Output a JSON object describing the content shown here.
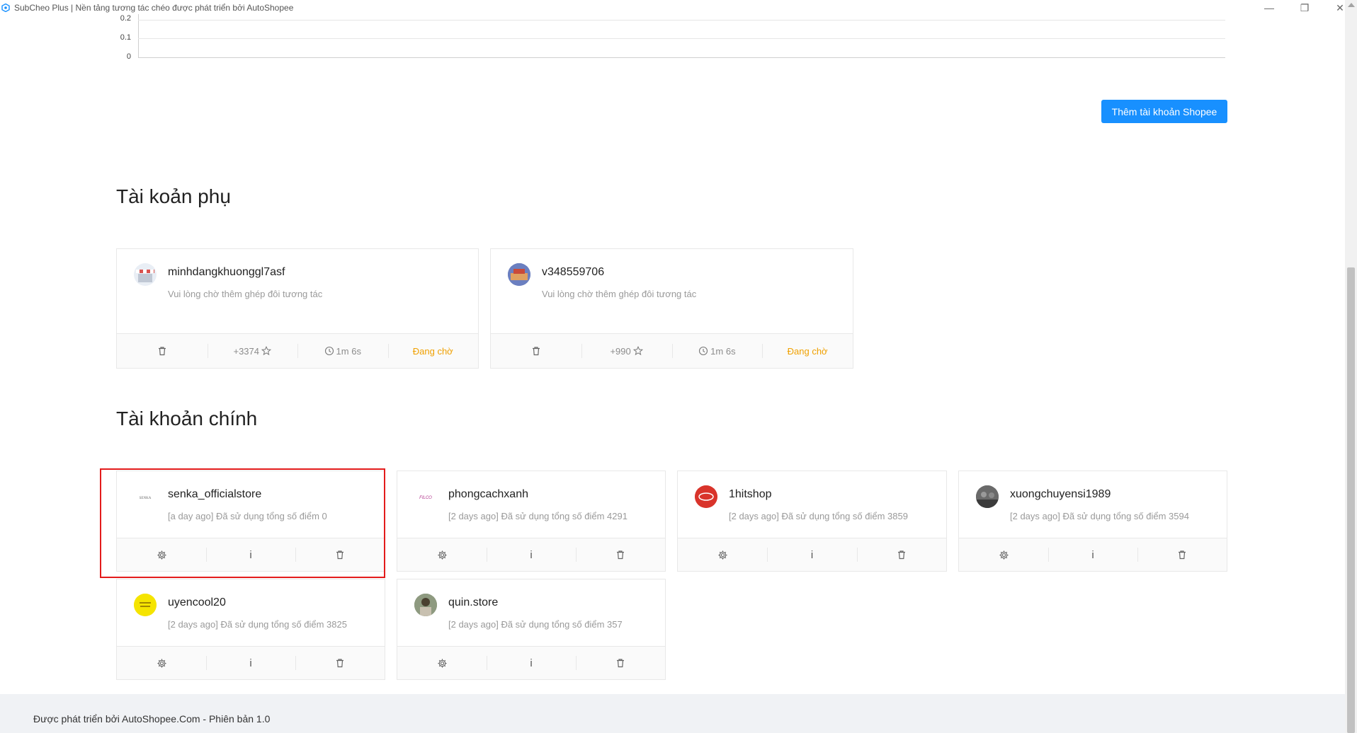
{
  "window": {
    "title": "SubCheo Plus | Nền tảng tương tác chéo được phát triển bởi AutoShopee",
    "minimize_glyph": "—",
    "restore_glyph": "❐",
    "close_glyph": "✕"
  },
  "chart": {
    "y_ticks": [
      "0.2",
      "0.1",
      "0"
    ]
  },
  "add_account_button": "Thêm tài khoản Shopee",
  "sub_section": {
    "title": "Tài koản phụ",
    "accounts": [
      {
        "name": "minhdangkhuonggl7asf",
        "desc": "Vui lòng chờ thêm ghép đôi tương tác",
        "points": "+3374",
        "time": "1m 6s",
        "status": "Đang chờ"
      },
      {
        "name": "v348559706",
        "desc": "Vui lòng chờ thêm ghép đôi tương tác",
        "points": "+990",
        "time": "1m 6s",
        "status": "Đang chờ"
      }
    ]
  },
  "main_section": {
    "title": "Tài khoản chính",
    "accounts": [
      {
        "name": "senka_officialstore",
        "desc": "[a day ago] Đã sử dụng tổng số điểm 0",
        "avatar_text": "SENKA"
      },
      {
        "name": "phongcachxanh",
        "desc": "[2 days ago] Đã sử dụng tổng số điểm 4291",
        "avatar_text": "FILCO"
      },
      {
        "name": "1hitshop",
        "desc": "[2 days ago] Đã sử dụng tổng số điểm 3859",
        "avatar_text": ""
      },
      {
        "name": "xuongchuyensi1989",
        "desc": "[2 days ago] Đã sử dụng tổng số điểm 3594",
        "avatar_text": ""
      },
      {
        "name": "uyencool20",
        "desc": "[2 days ago] Đã sử dụng tổng số điểm 3825",
        "avatar_text": ""
      },
      {
        "name": "quin.store",
        "desc": "[2 days ago] Đã sử dụng tổng số điểm 357",
        "avatar_text": ""
      }
    ],
    "info_glyph": "i"
  },
  "footer": {
    "text": "Được phát triển bởi AutoShopee.Com - Phiên bản 1.0"
  },
  "colors": {
    "primary": "#1890ff",
    "waiting": "#f0a000",
    "highlight": "#e31b1b"
  }
}
